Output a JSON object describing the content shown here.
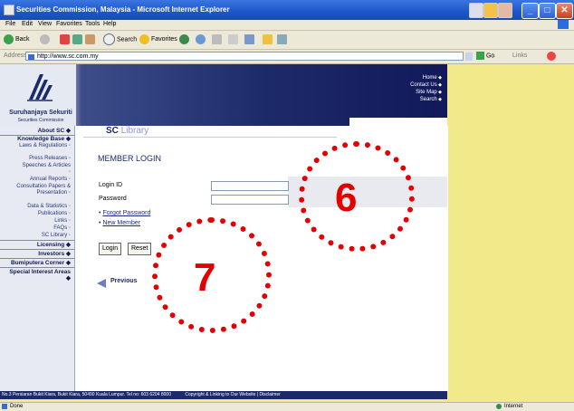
{
  "window": {
    "title": "Securities Commission, Malaysia - Microsoft Internet Explorer",
    "minimize_label": "_",
    "maximize_label": "□",
    "close_label": "✕"
  },
  "menu": [
    "File",
    "Edit",
    "View",
    "Favorites",
    "Tools",
    "Help"
  ],
  "toolbar": {
    "back_label": "Back",
    "search_label": "Search",
    "favorites_label": "Favorites"
  },
  "address": {
    "label": "Address",
    "url": "http://www.sc.com.my",
    "go_label": "Go",
    "links_label": "Links"
  },
  "header": {
    "org_name": "Suruhanjaya Sekuriti",
    "org_sub": "Securities Commission",
    "top_links": [
      "Home",
      "Contact Us",
      "Site Map",
      "Search"
    ]
  },
  "sidebar": {
    "about": "About SC",
    "knowledge_base": "Knowledge Base",
    "kb_items": [
      "Laws & Regulations",
      "Press Releases",
      "Speeches & Articles",
      "Annual Reports",
      "Consultation Papers & Presentation",
      "Data & Statistics",
      "Publications",
      "Links",
      "FAQs",
      "SC Library"
    ],
    "licensing": "Licensing",
    "investors": "Investors",
    "bumiputera": "Bumiputera Corner",
    "special": "Special Interest Areas"
  },
  "main": {
    "section_sc": "SC",
    "section_library": "Library",
    "title": "MEMBER LOGIN",
    "login_id_label": "Login ID",
    "password_label": "Password",
    "forgot_password": "Forgot Password",
    "new_member": "New Member",
    "login_button": "Login",
    "reset_button": "Reset",
    "previous": "Previous"
  },
  "annotations": {
    "six": "6",
    "seven": "7",
    "color": "#e30000"
  },
  "footer": {
    "address": "No.3 Persiaran Bukit Kiara, Bukit Kiara, 50490 Kuala Lumpur. Tel no: 603 6204 8000",
    "links": "Copyright & Linking to Our Website | Disclaimer"
  },
  "status": {
    "left": "Done",
    "right": "Internet"
  }
}
